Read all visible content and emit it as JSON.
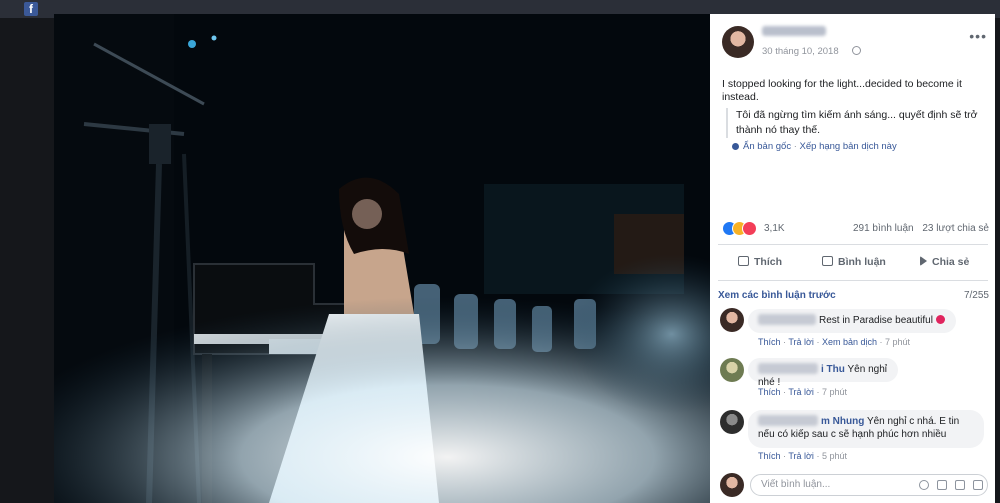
{
  "post": {
    "date": "30 tháng 10, 2018",
    "text": "I stopped looking for the light...decided to become it instead.",
    "translation": "Tôi đã ngừng tìm kiếm ánh sáng... quyết định sẽ trở thành nó thay thế.",
    "show_original": "Ẩn bản gốc",
    "rate_translation": "Xếp hạng bản dịch này",
    "more_icon": "ellipsis-icon",
    "privacy_icon": "globe-icon"
  },
  "stats": {
    "reactions": "3,1K",
    "comments": "291 bình luận",
    "shares": "23 lượt chia sẻ"
  },
  "actions": {
    "like": "Thích",
    "comment": "Bình luận",
    "share": "Chia sẻ"
  },
  "comments_section": {
    "view_previous": "Xem các bình luận trước",
    "pager": "7/255",
    "items": [
      {
        "author_visible": "",
        "text": "Rest in Paradise beautiful",
        "like": "Thích",
        "reply": "Trả lời",
        "translate": "Xem bản dịch",
        "time": "7 phút"
      },
      {
        "author_visible": "i Thu",
        "text": "Yên nghỉ nhé !",
        "like": "Thích",
        "reply": "Trả lời",
        "time": "7 phút"
      },
      {
        "author_visible": "m Nhung",
        "text": "Yên nghỉ c nhá. E tin",
        "text2": "nếu có kiếp sau c sẽ hạnh phúc hơn nhiều",
        "like": "Thích",
        "reply": "Trả lời",
        "time": "5 phút"
      }
    ],
    "write_placeholder": "Viết bình luận..."
  },
  "colors": {
    "link": "#385898",
    "like_reaction": "#2078f4",
    "wow_reaction": "#f7b125",
    "love_reaction": "#f33e58"
  }
}
